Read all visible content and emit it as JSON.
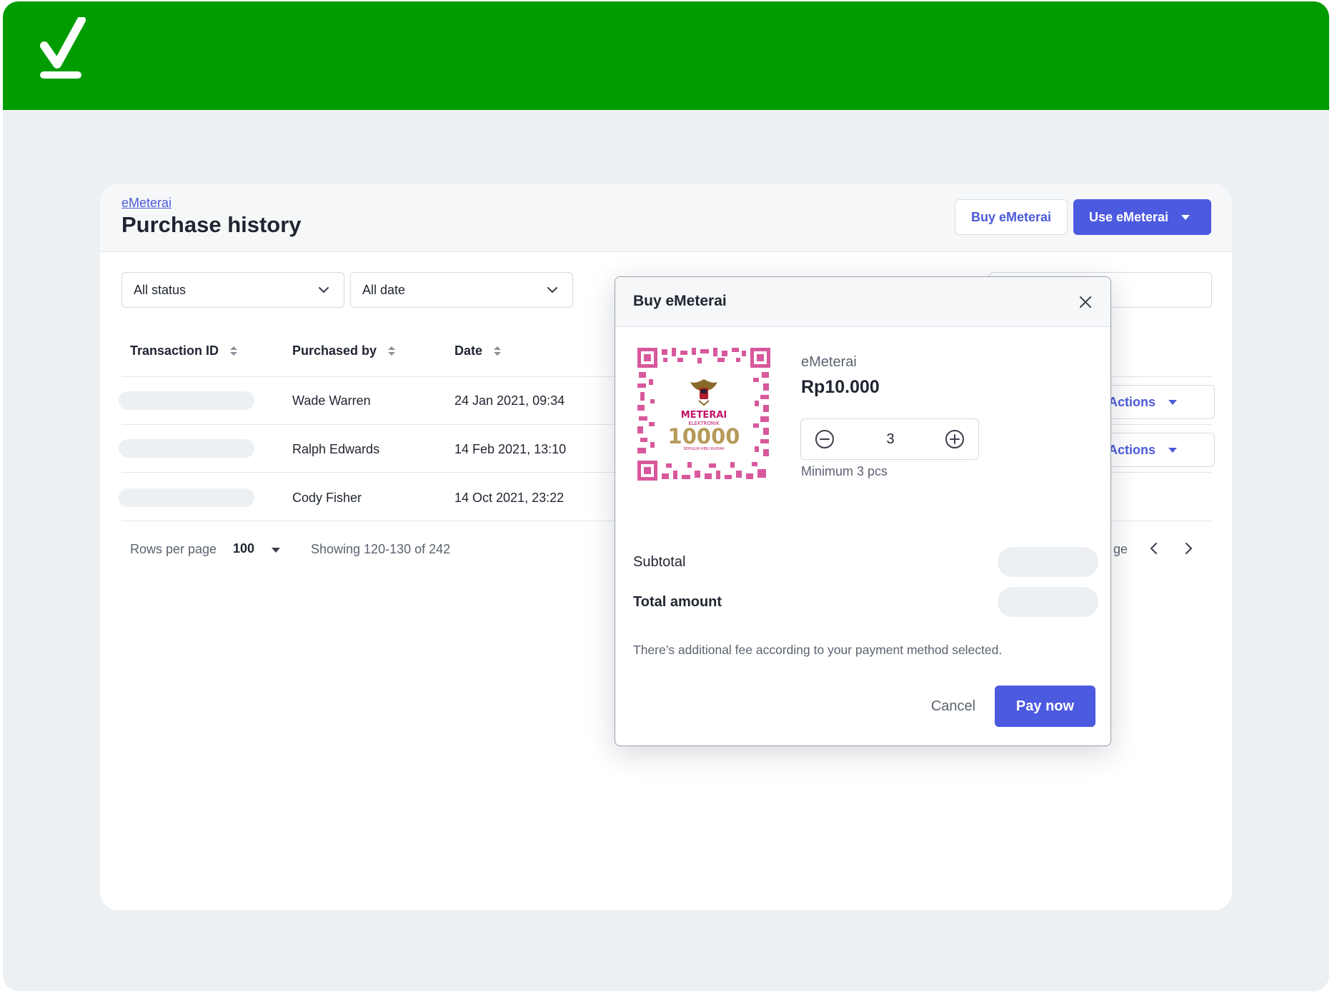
{
  "header": {
    "logo_icon": "checkmark-logo",
    "brand_color": "#009c00"
  },
  "breadcrumb": "eMeterai",
  "page_title": "Purchase history",
  "toolbar": {
    "buy_label": "Buy eMeterai",
    "use_label": "Use eMeterai",
    "accent": "#4c5ae0"
  },
  "filters": {
    "status": "All status",
    "date": "All date"
  },
  "table": {
    "columns": [
      "Transaction ID",
      "Purchased by",
      "Date"
    ],
    "rows": [
      {
        "purchased_by": "Wade Warren",
        "date": "24 Jan 2021, 09:34",
        "action": "Actions"
      },
      {
        "purchased_by": "Ralph Edwards",
        "date": "14 Feb 2021, 13:10",
        "action": "Actions"
      },
      {
        "purchased_by": "Cody Fisher",
        "date": "14 Oct 2021, 23:22",
        "action": ""
      }
    ]
  },
  "pagination": {
    "rows_label": "Rows per page",
    "rows_value": "100",
    "showing": "Showing 120-130 of 242",
    "page_label": "ge"
  },
  "modal": {
    "title": "Buy eMeterai",
    "product_name": "eMeterai",
    "price": "Rp10.000",
    "quantity": "3",
    "min_note": "Minimum 3 pcs",
    "subtotal_label": "Subtotal",
    "total_label": "Total amount",
    "fee_note": "There’s additional fee according to your payment method selected.",
    "cancel_label": "Cancel",
    "pay_label": "Pay now",
    "stamp": {
      "line1": "METERAI",
      "line2": "ELEKTRONIK",
      "value": "10000",
      "words": "SEPULUH RIBU RUPIAH"
    }
  }
}
